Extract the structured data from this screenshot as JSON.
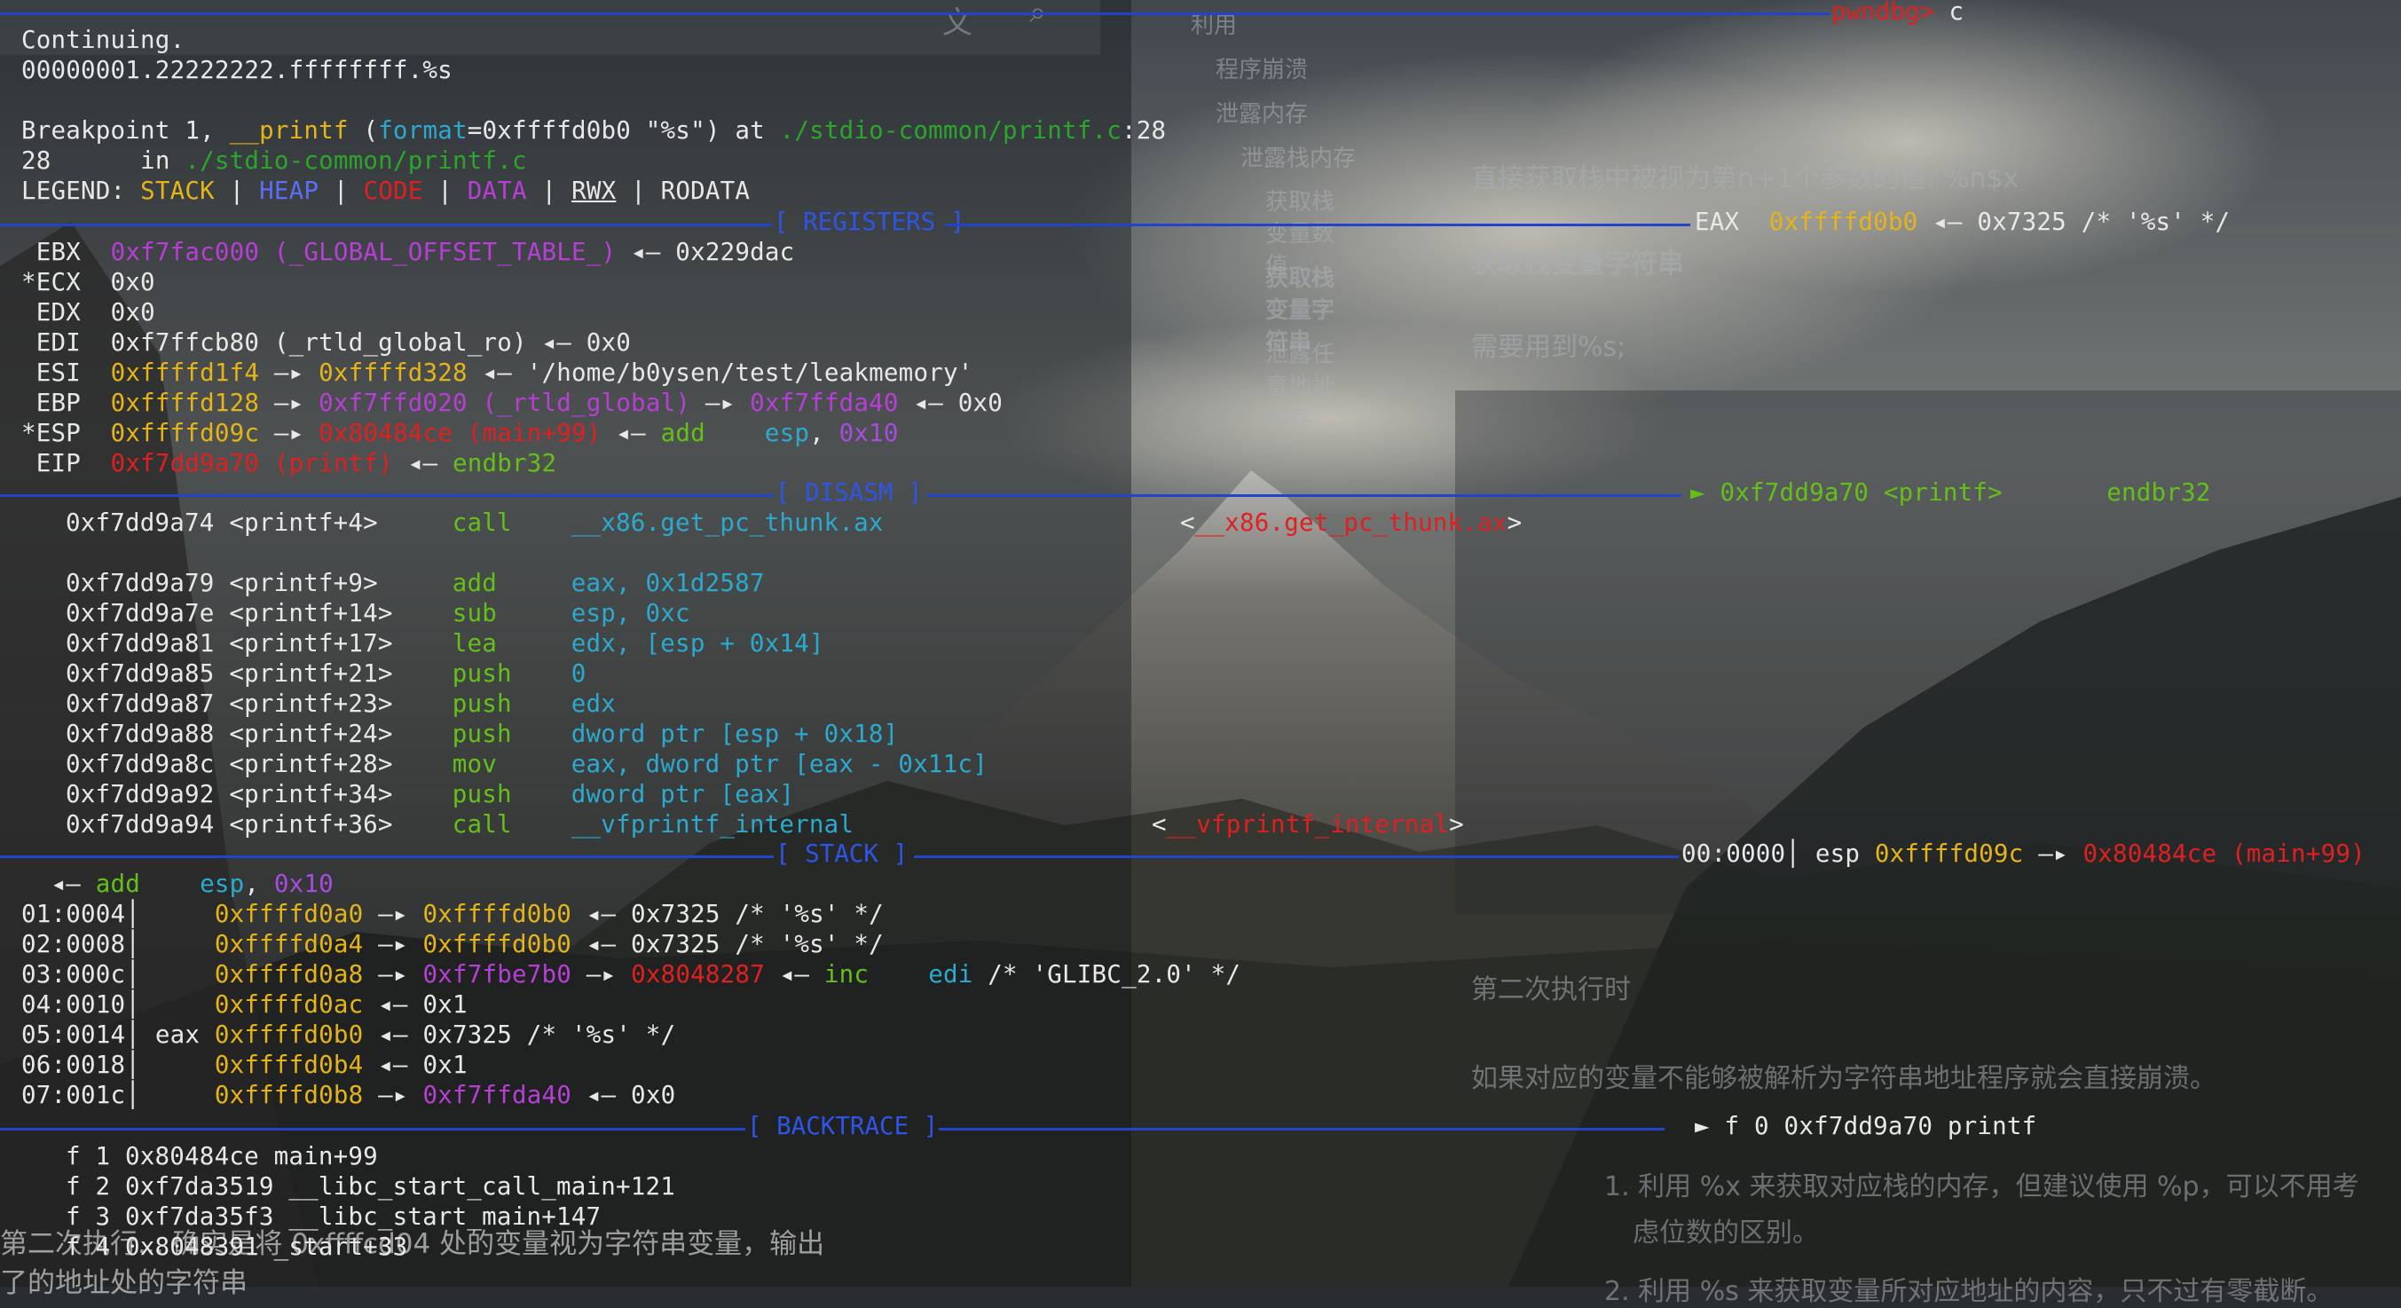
{
  "colors": {
    "stack": "#e5b418",
    "heap": "#5b6ef5",
    "code": "#e02020",
    "data": "#b73fd6",
    "rwx": "#e8e8e8",
    "header_rule": "#2244cc",
    "prompt": "#e02020"
  },
  "prompt": {
    "label": "pwndbg>",
    "command": "c"
  },
  "intro": {
    "continuing": "Continuing.",
    "output": "00000001.22222222.ffffffff.%s",
    "bp_prefix": "Breakpoint 1, ",
    "bp_func": "__printf",
    "bp_open": " (",
    "bp_param": "format",
    "bp_val": "=0xffffd0b0 \"%s\") at ",
    "bp_file": "./stdio-common/printf.c",
    "bp_line": ":28",
    "src_num": "28",
    "src_in": "\tin ",
    "src_file": "./stdio-common/printf.c"
  },
  "legend": {
    "label": "LEGEND: ",
    "stack": "STACK",
    "heap": "HEAP",
    "code": "CODE",
    "data": "DATA",
    "rwx": "RWX",
    "rodata": "RODATA",
    "sep": " | "
  },
  "sections": {
    "registers": "[ REGISTERS ]",
    "disasm": "[ DISASM ]",
    "stack": "[ STACK ]",
    "backtrace": "[ BACKTRACE ]"
  },
  "registers": {
    "eax": {
      "name": "EAX",
      "a": "0xffffd0b0",
      "rest": " ◂— 0x7325 /* '%s' */"
    },
    "ebx": {
      "name": "EBX",
      "a": "0xf7fac000 (_GLOBAL_OFFSET_TABLE_)",
      "rest": " ◂— 0x229dac"
    },
    "ecx": {
      "name": "*ECX",
      "val": "0x0"
    },
    "edx": {
      "name": "EDX",
      "val": "0x0"
    },
    "edi": {
      "name": "EDI",
      "val": "0xf7ffcb80 (_rtld_global_ro) ◂— 0x0"
    },
    "esi": {
      "name": "ESI",
      "a": "0xffffd1f4",
      "arrow": " —▸ ",
      "b": "0xffffd328",
      "rest": " ◂— '/home/b0ysen/test/leakmemory'"
    },
    "ebp": {
      "name": "EBP",
      "a": "0xffffd128",
      "arrow": " —▸ ",
      "b": "0xf7ffd020 (_rtld_global)",
      "arrow2": " —▸ ",
      "c": "0xf7ffda40",
      "rest": " ◂— 0x0"
    },
    "esp": {
      "name": "*ESP",
      "a": "0xffffd09c",
      "arrow": " —▸ ",
      "b": "0x80484ce (main+99)",
      "mid": " ◂— ",
      "ins": "add",
      "ops1": "    esp",
      "comma": ", ",
      "ops2": "0x10"
    },
    "eip": {
      "name": "EIP",
      "a": "0x7dd9a70 (printf)",
      "a_full": "0xf7dd9a70 (printf)",
      "rest": " ◂— ",
      "ins": "endbr32"
    }
  },
  "disasm": {
    "current": {
      "marker": "►",
      "addr": "0xf7dd9a70 <printf>",
      "ins": "endbr32"
    },
    "lines": [
      {
        "addr": "0xf7dd9a74 <printf+4>",
        "op": "call",
        "args": "__x86.get_pc_thunk.ax"
      },
      {
        "addr": "0xf7dd9a79 <printf+9>",
        "op": "add",
        "args": "eax, 0x1d2587"
      },
      {
        "addr": "0xf7dd9a7e <printf+14>",
        "op": "sub",
        "args": "esp, 0xc"
      },
      {
        "addr": "0xf7dd9a81 <printf+17>",
        "op": "lea",
        "args": "edx, [esp + 0x14]"
      },
      {
        "addr": "0xf7dd9a85 <printf+21>",
        "op": "push",
        "args": "0"
      },
      {
        "addr": "0xf7dd9a87 <printf+23>",
        "op": "push",
        "args": "edx"
      },
      {
        "addr": "0xf7dd9a88 <printf+24>",
        "op": "push",
        "args": "dword ptr [esp + 0x18]"
      },
      {
        "addr": "0xf7dd9a8c <printf+28>",
        "op": "mov",
        "args": "eax, dword ptr [eax - 0x11c]"
      },
      {
        "addr": "0xf7dd9a92 <printf+34>",
        "op": "push",
        "args": "dword ptr [eax]"
      },
      {
        "addr": "0xf7dd9a94 <printf+36>",
        "op": "call",
        "args": "__vfprintf_internal"
      }
    ],
    "target1": "__x86.get_pc_thunk.ax",
    "target2": "__vfprintf_internal"
  },
  "stack": {
    "first": {
      "idx": "00:0000",
      "reg": "esp",
      "a": "0xffffd09c",
      "arrow": " —▸ ",
      "b": "0x80484ce (main+99)"
    },
    "first_cont": {
      "mid": " ◂— ",
      "ins": "add",
      "ops": "esp",
      "val": "0x10"
    },
    "rows": [
      {
        "idx": "01:0004",
        "reg": "",
        "a": "0xffffd0a0",
        "arrow": " —▸ ",
        "b": "0xffffd0b0",
        "rest": " ◂— 0x7325 /* '%s' */"
      },
      {
        "idx": "02:0008",
        "reg": "",
        "a": "0xffffd0a4",
        "arrow": " —▸ ",
        "b": "0xffffd0b0",
        "rest": " ◂— 0x7325 /* '%s' */"
      },
      {
        "idx": "03:000c",
        "reg": "",
        "a": "0xffffd0a8",
        "arrow": " —▸ ",
        "b": "0xf7fbe7b0",
        "arrow2": " —▸ ",
        "c": "0x8048287",
        "mid": " ◂— ",
        "ins": "inc",
        "ops": "edi",
        "rest": " /* 'GLIBC_2.0' */"
      },
      {
        "idx": "04:0010",
        "reg": "",
        "a": "0xffffd0ac",
        "rest": " ◂— 0x1"
      },
      {
        "idx": "05:0014",
        "reg": "eax",
        "a": "0xffffd0b0",
        "rest": " ◂— 0x7325 /* '%s' */"
      },
      {
        "idx": "06:0018",
        "reg": "",
        "a": "0xffffd0b4",
        "rest": " ◂— 0x1"
      },
      {
        "idx": "07:001c",
        "reg": "",
        "a": "0xffffd0b8",
        "arrow": " —▸ ",
        "b": "0xf7ffda40",
        "rest": " ◂— 0x0"
      }
    ]
  },
  "backtrace": [
    {
      "marker": "►",
      "text": "f 0 0xf7dd9a70 printf"
    },
    {
      "marker": "",
      "text": "f 1 0x80484ce main+99"
    },
    {
      "marker": "",
      "text": "f 2 0xf7da3519 __libc_start_call_main+121"
    },
    {
      "marker": "",
      "text": "f 3 0xf7da35f3 __libc_start_main+147"
    },
    {
      "marker": "",
      "text": "f 4 0x8048391 _start+33"
    }
  ],
  "background_doc": {
    "toc": [
      "利用",
      "程序崩溃",
      "泄露内存",
      "泄露栈内存",
      "获取栈变量数值",
      "获取栈变量字符串",
      "泄露任意地址内存"
    ],
    "h_direct": "直接获取栈中被视为第n+1个参数的值:  %n$x",
    "h_string": "获取栈变量字符串",
    "p_need": "需要用到%s;",
    "h_second": "第二次执行时",
    "p_crash": "如果对应的变量不能够被解析为字符串地址程序就会直接崩溃。",
    "li1": "1. 利用 %x 来获取对应栈的内存，但建议使用 %p，可以不用考",
    "li1b": "虑位数的区别。",
    "li2": "2. 利用 %s 来获取变量所对应地址的内容，只不过有零截断。",
    "bottom1": "第二次执行...               确实是将 0xffffcd04 处的变量视为字符串变量，输出",
    "bottom2": "了的地址处的字符串"
  }
}
